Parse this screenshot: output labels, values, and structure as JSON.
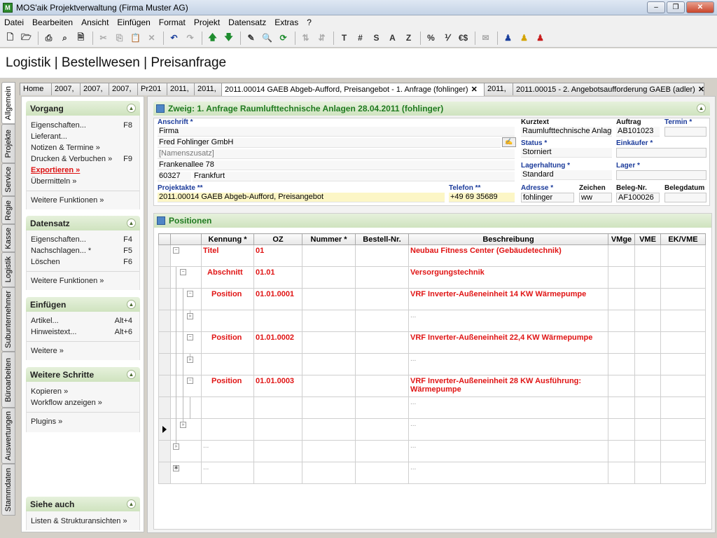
{
  "window": {
    "title": "MOS'aik Projektverwaltung (Firma Muster AG)"
  },
  "menu": [
    "Datei",
    "Bearbeiten",
    "Ansicht",
    "Einfügen",
    "Format",
    "Projekt",
    "Datensatz",
    "Extras",
    "?"
  ],
  "toolbar": {
    "text_buttons": [
      "T",
      "#",
      "S",
      "A",
      "Z",
      "%",
      "€$"
    ]
  },
  "page_title": "Logistik | Bestellwesen | Preisanfrage",
  "side_tabs": [
    "Allgemein",
    "Projekte",
    "Service",
    "Regie",
    "Kasse",
    "Logistik",
    "Subunternehmer",
    "Büroarbeiten",
    "Auswertungen",
    "Stammdaten"
  ],
  "doc_tabs": [
    "Home",
    "2007,",
    "2007,",
    "2007,",
    "Pr201",
    "2011,",
    "2011,",
    "2011.00014 GAEB Abgeb-Aufford, Preisangebot - 1. Anfrage (fohlinger)",
    "2011,",
    "2011.00015 - 2. Angebotsaufforderung GAEB (adler)"
  ],
  "left": {
    "vorgang": {
      "title": "Vorgang",
      "items": [
        {
          "label": "Eigenschaften...",
          "key": "F8"
        },
        {
          "label": "Lieferant...",
          "key": ""
        },
        {
          "label": "Notizen & Termine »",
          "key": ""
        },
        {
          "label": "Drucken & Verbuchen »",
          "key": "F9"
        },
        {
          "label": "Exportieren »",
          "key": ""
        },
        {
          "label": "Übermitteln »",
          "key": ""
        }
      ],
      "more": "Weitere Funktionen »"
    },
    "datensatz": {
      "title": "Datensatz",
      "items": [
        {
          "label": "Eigenschaften...",
          "key": "F4"
        },
        {
          "label": "Nachschlagen... *",
          "key": "F5"
        },
        {
          "label": "Löschen",
          "key": "F6"
        }
      ],
      "more": "Weitere Funktionen »"
    },
    "einfuegen": {
      "title": "Einfügen",
      "items": [
        {
          "label": "Artikel...",
          "key": "Alt+4"
        },
        {
          "label": "Hinweistext...",
          "key": "Alt+6"
        }
      ],
      "more": "Weitere »"
    },
    "schritte": {
      "title": "Weitere Schritte",
      "items": [
        {
          "label": "Kopieren »"
        },
        {
          "label": "Workflow anzeigen »"
        }
      ],
      "more": "Plugins »"
    },
    "siehe": {
      "title": "Siehe auch",
      "items": [
        {
          "label": "Listen & Strukturansichten »"
        }
      ]
    }
  },
  "zweig": {
    "title": "Zweig: 1. Anfrage Raumlufttechnische Anlagen 28.04.2011 (fohlinger)"
  },
  "form": {
    "anschrift_label": "Anschrift *",
    "anrede": "Firma",
    "name": "Fred Fohlinger GmbH",
    "namenszusatz": "[Namenszusatz]",
    "strasse": "Frankenallee 78",
    "plz": "60327",
    "ort": "Frankfurt",
    "projektakte_label": "Projektakte **",
    "projektakte": "2011.00014 GAEB Abgeb-Aufford, Preisangebot",
    "telefon_label": "Telefon **",
    "telefon": "+49 69 35689",
    "kurztext_label": "Kurztext",
    "kurztext": "Raumlufttechnische Anlage",
    "status_label": "Status *",
    "status": "Storniert",
    "lagerhaltung_label": "Lagerhaltung *",
    "lagerhaltung": "Standard",
    "adresse_label": "Adresse *",
    "adresse": "fohlinger",
    "zeichen_label": "Zeichen",
    "zeichen": "ww",
    "auftrag_label": "Auftrag",
    "auftrag": "AB101023",
    "termin_label": "Termin *",
    "einkaeufer_label": "Einkäufer *",
    "lager_label": "Lager *",
    "belegnr_label": "Beleg-Nr.",
    "belegnr": "AF100026",
    "belegdatum_label": "Belegdatum"
  },
  "positionen": {
    "title": "Positionen",
    "columns": [
      "Kennung *",
      "OZ",
      "Nummer *",
      "Bestell-Nr.",
      "Beschreibung",
      "VMge",
      "VME",
      "EK/VME"
    ],
    "rows": [
      {
        "kennung": "Titel",
        "oz": "01",
        "beschreibung": "Neubau Fitness Center (Gebäudetechnik)"
      },
      {
        "kennung": "Abschnitt",
        "oz": "01.01",
        "beschreibung": "Versorgungstechnik"
      },
      {
        "kennung": "Position",
        "oz": "01.01.0001",
        "beschreibung": "VRF Inverter-Außeneinheit 14 KW Wärmepumpe"
      },
      {
        "kennung": "",
        "oz": "",
        "beschreibung": "..."
      },
      {
        "kennung": "Position",
        "oz": "01.01.0002",
        "beschreibung": "VRF Inverter-Außeneinheit 22,4 KW Wärmepumpe"
      },
      {
        "kennung": "",
        "oz": "",
        "beschreibung": "..."
      },
      {
        "kennung": "Position",
        "oz": "01.01.0003",
        "beschreibung": "VRF Inverter-Außeneinheit 28 KW Ausführung: Wärmepumpe"
      },
      {
        "kennung": "",
        "oz": "",
        "beschreibung": "..."
      },
      {
        "kennung": "",
        "oz": "",
        "beschreibung": "..."
      },
      {
        "kennung": "...",
        "oz": "",
        "beschreibung": "..."
      },
      {
        "kennung": "...",
        "oz": "",
        "beschreibung": "..."
      }
    ]
  }
}
